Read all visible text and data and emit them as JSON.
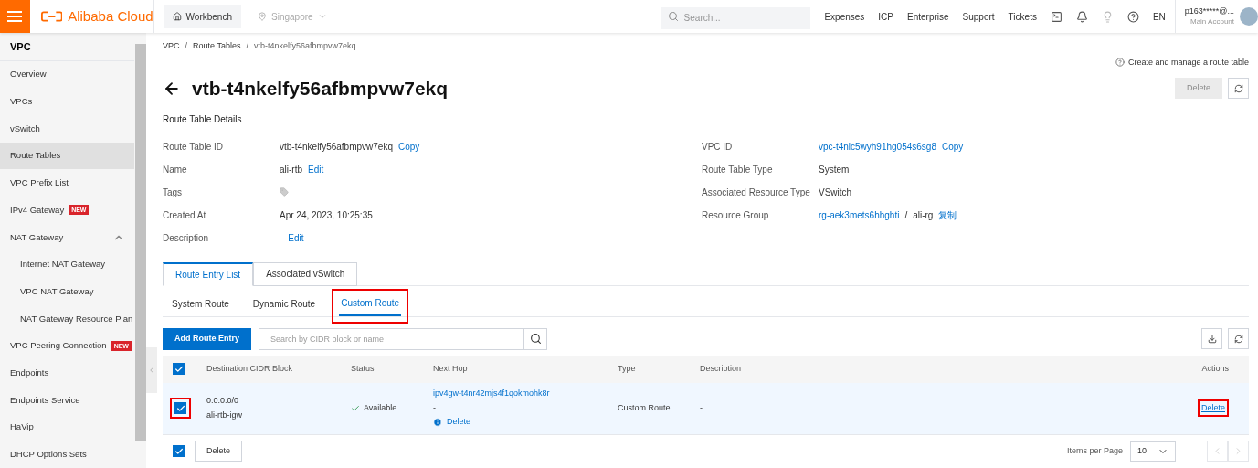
{
  "header": {
    "logo": "Alibaba Cloud",
    "workbench": "Workbench",
    "region": "Singapore",
    "search_placeholder": "Search...",
    "nav": [
      "Expenses",
      "ICP",
      "Enterprise",
      "Support",
      "Tickets"
    ],
    "language": "EN",
    "account": {
      "name": "p163*****@...",
      "role": "Main Account"
    }
  },
  "sidebar": {
    "title": "VPC",
    "items": [
      {
        "label": "Overview",
        "selected": false
      },
      {
        "label": "VPCs",
        "selected": false
      },
      {
        "label": "vSwitch",
        "selected": false
      },
      {
        "label": "Route Tables",
        "selected": true
      },
      {
        "label": "VPC Prefix List",
        "selected": false
      },
      {
        "label": "IPv4 Gateway",
        "selected": false,
        "badge": "NEW"
      },
      {
        "label": "NAT Gateway",
        "selected": false,
        "expanded": true,
        "children": [
          {
            "label": "Internet NAT Gateway",
            "selected": false
          },
          {
            "label": "VPC NAT Gateway",
            "selected": false
          },
          {
            "label": "NAT Gateway Resource Plan",
            "selected": false
          }
        ]
      },
      {
        "label": "VPC Peering Connection",
        "selected": false,
        "badge": "NEW"
      },
      {
        "label": "Endpoints",
        "selected": false
      },
      {
        "label": "Endpoints Service",
        "selected": false
      },
      {
        "label": "HaVip",
        "selected": false
      },
      {
        "label": "DHCP Options Sets",
        "selected": false
      }
    ]
  },
  "breadcrumb": [
    "VPC",
    "Route Tables",
    "vtb-t4nkelfy56afbmpvw7ekq"
  ],
  "breadcrumb_separator": "/",
  "help_link": "Create and manage a route table",
  "title": "vtb-t4nkelfy56afbmpvw7ekq",
  "delete_button": {
    "label": "Delete",
    "disabled": true
  },
  "details": {
    "title": "Route Table Details",
    "left": [
      {
        "label": "Route Table ID",
        "kind": "text",
        "value": "vtb-t4nkelfy56afbmpvw7ekq",
        "action": "Copy"
      },
      {
        "label": "Name",
        "kind": "text",
        "value": "ali-rtb",
        "action": "Edit"
      },
      {
        "label": "Tags",
        "kind": "tag"
      },
      {
        "label": "Created At",
        "kind": "text",
        "value": "Apr 24, 2023, 10:25:35"
      },
      {
        "label": "Description",
        "kind": "text",
        "value": "-",
        "action": "Edit"
      }
    ],
    "right": [
      {
        "label": "VPC ID",
        "kind": "link",
        "value": "vpc-t4nic5wyh91hg054s6sg8",
        "action": "Copy"
      },
      {
        "label": "Route Table Type",
        "kind": "text",
        "value": "System"
      },
      {
        "label": "Associated Resource Type",
        "kind": "text",
        "value": "VSwitch"
      },
      {
        "label": "Resource Group",
        "kind": "group",
        "value": "rg-aek3mets6hhghti",
        "separator": "/",
        "suffix": "ali-rg",
        "action": "复制"
      }
    ]
  },
  "tabs": [
    {
      "label": "Route Entry List",
      "selected": true
    },
    {
      "label": "Associated vSwitch",
      "selected": false
    }
  ],
  "subtabs": [
    {
      "label": "System Route",
      "selected": false,
      "highlighted": false
    },
    {
      "label": "Dynamic Route",
      "selected": false,
      "highlighted": false
    },
    {
      "label": "Custom Route",
      "selected": true,
      "highlighted": true
    }
  ],
  "add_button": "Add Route Entry",
  "table_search_placeholder": "Search by CIDR block or name",
  "table": {
    "all_checked": true,
    "columns": [
      "Destination CIDR Block",
      "Status",
      "Next Hop",
      "Type",
      "Description",
      "Actions"
    ],
    "rows": [
      {
        "checked": true,
        "highlighted": true,
        "destination": "0.0.0.0/0",
        "name": "ali-rtb-igw",
        "status": "Available",
        "next_hop": "ipv4gw-t4nr42mjs4f1qokmohk8r",
        "next_hop_note": "-",
        "next_hop_action": "Delete",
        "type": "Custom Route",
        "description": "-",
        "action": "Delete",
        "action_highlighted": true
      }
    ]
  },
  "footer": {
    "checked": true,
    "delete": "Delete",
    "page_size_label": "Items per Page",
    "page_size": "10"
  }
}
